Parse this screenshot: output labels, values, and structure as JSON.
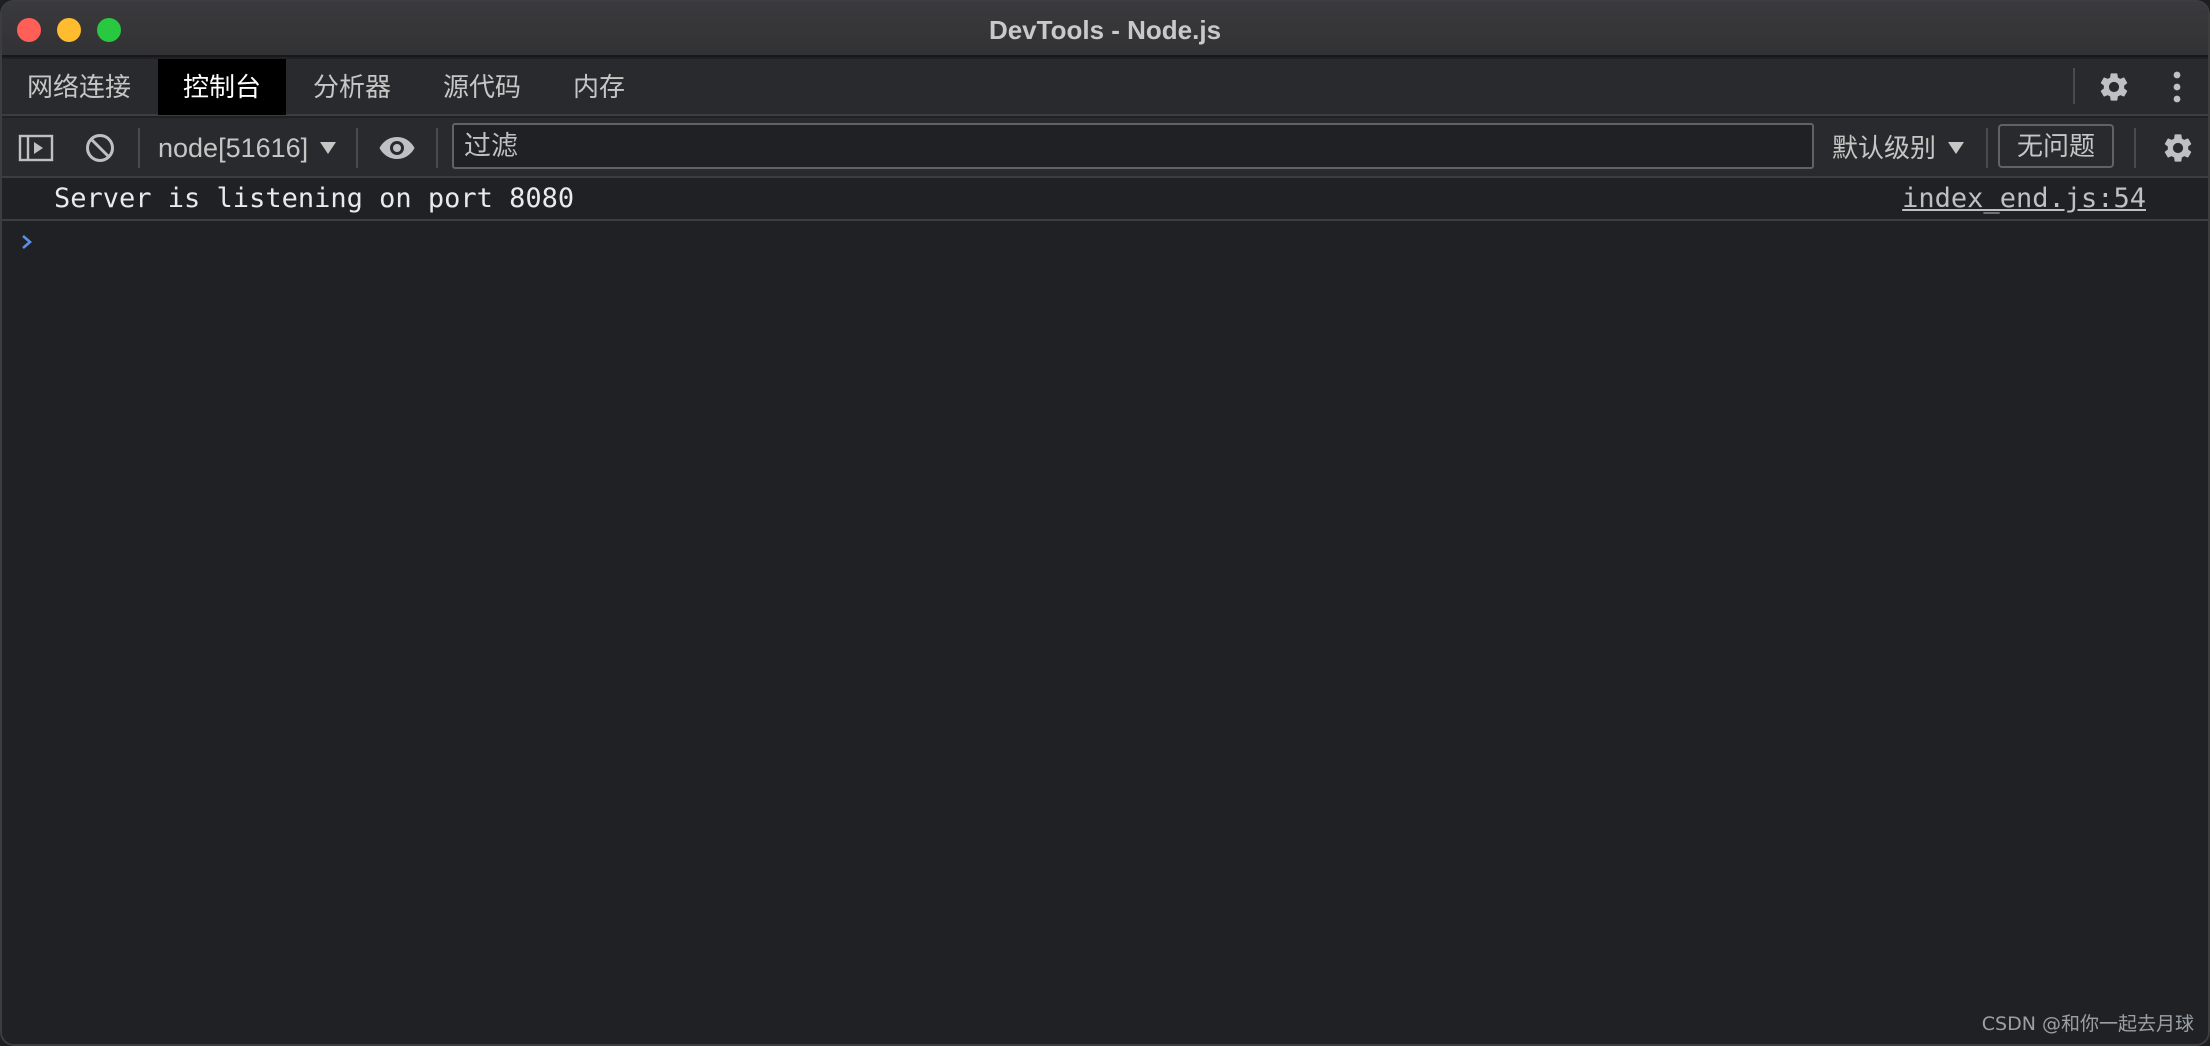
{
  "window": {
    "title": "DevTools - Node.js"
  },
  "tabs": [
    {
      "label": "网络连接",
      "active": false
    },
    {
      "label": "控制台",
      "active": true
    },
    {
      "label": "分析器",
      "active": false
    },
    {
      "label": "源代码",
      "active": false
    },
    {
      "label": "内存",
      "active": false
    }
  ],
  "toolbar": {
    "context": "node[51616]",
    "filter_placeholder": "过滤",
    "filter_value": "",
    "level": "默认级别",
    "issues": "无问题"
  },
  "console": {
    "messages": [
      {
        "text": "Server is listening on port 8080",
        "source": "index_end.js:54"
      }
    ]
  },
  "watermark": "CSDN @和你一起去月球",
  "colors": {
    "background": "#202124",
    "toolbar": "#292a2d",
    "active_tab": "#000000",
    "prompt": "#5c8ee6",
    "text": "#e8eaed"
  },
  "icons": [
    "sidebar-toggle-icon",
    "clear-console-icon",
    "eye-icon",
    "gear-icon",
    "more-vertical-icon",
    "prompt-chevron-icon"
  ]
}
